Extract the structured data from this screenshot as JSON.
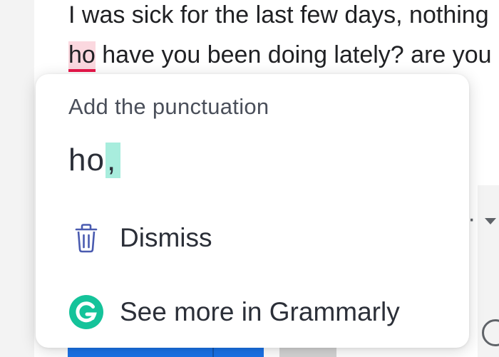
{
  "editor": {
    "line1": "I was sick for the last few days, nothing",
    "line2_flagged": "ho",
    "line2_rest": " have you been doing lately? are you"
  },
  "suggestion_card": {
    "heading": "Add the punctuation",
    "suggestion_word": "ho",
    "suggestion_insert": ",",
    "dismiss_label": "Dismiss",
    "see_more_label": "See more in Grammarly",
    "icons": {
      "dismiss": "trash-icon",
      "see_more": "grammarly-logo-icon"
    },
    "colors": {
      "insert_highlight": "#a8eddd",
      "grammarly_green": "#15c39a",
      "flag_underline": "#e8174a",
      "flag_background": "#fbd8df"
    }
  }
}
